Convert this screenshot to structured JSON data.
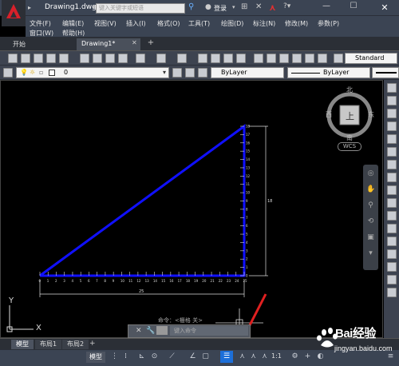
{
  "title_bar": {
    "document_title": "Drawing1.dwg",
    "search_placeholder": "键入关键字或短语",
    "login_label": "登录"
  },
  "menu_bar": {
    "items": [
      "文件(F)",
      "编辑(E)",
      "视图(V)",
      "插入(I)",
      "格式(O)",
      "工具(T)",
      "绘图(D)",
      "标注(N)",
      "修改(M)",
      "参数(P)",
      "窗口(W)",
      "帮助(H)"
    ]
  },
  "file_tabs": {
    "start": "开始",
    "drawing": "Drawing1*"
  },
  "toolbar": {
    "text_style": "Standard",
    "layer_value": "0",
    "color_value": "ByLayer",
    "linetype_value": "ByLayer"
  },
  "viewcube": {
    "north": "北",
    "south": "南",
    "east": "东",
    "west": "西",
    "top": "上",
    "wcs": "WCS"
  },
  "ucs": {
    "x_label": "X",
    "y_label": "Y"
  },
  "drawing": {
    "horizontal_dimension": "25",
    "vertical_dimension": "18"
  },
  "command_line": {
    "history": "命令：<栅格 关>",
    "input_placeholder": "键入命令"
  },
  "layout_tabs": [
    "模型",
    "布局1",
    "布局2"
  ],
  "status_bar": {
    "model_label": "模型",
    "scale_label": "1:1"
  },
  "watermark": {
    "text": "Bai经验",
    "url": "jingyan.baidu.com"
  },
  "colors": {
    "triangle_line": "#1010ff",
    "highlight_arrow": "#e02020",
    "annotation_active": "#1c6fd9"
  }
}
